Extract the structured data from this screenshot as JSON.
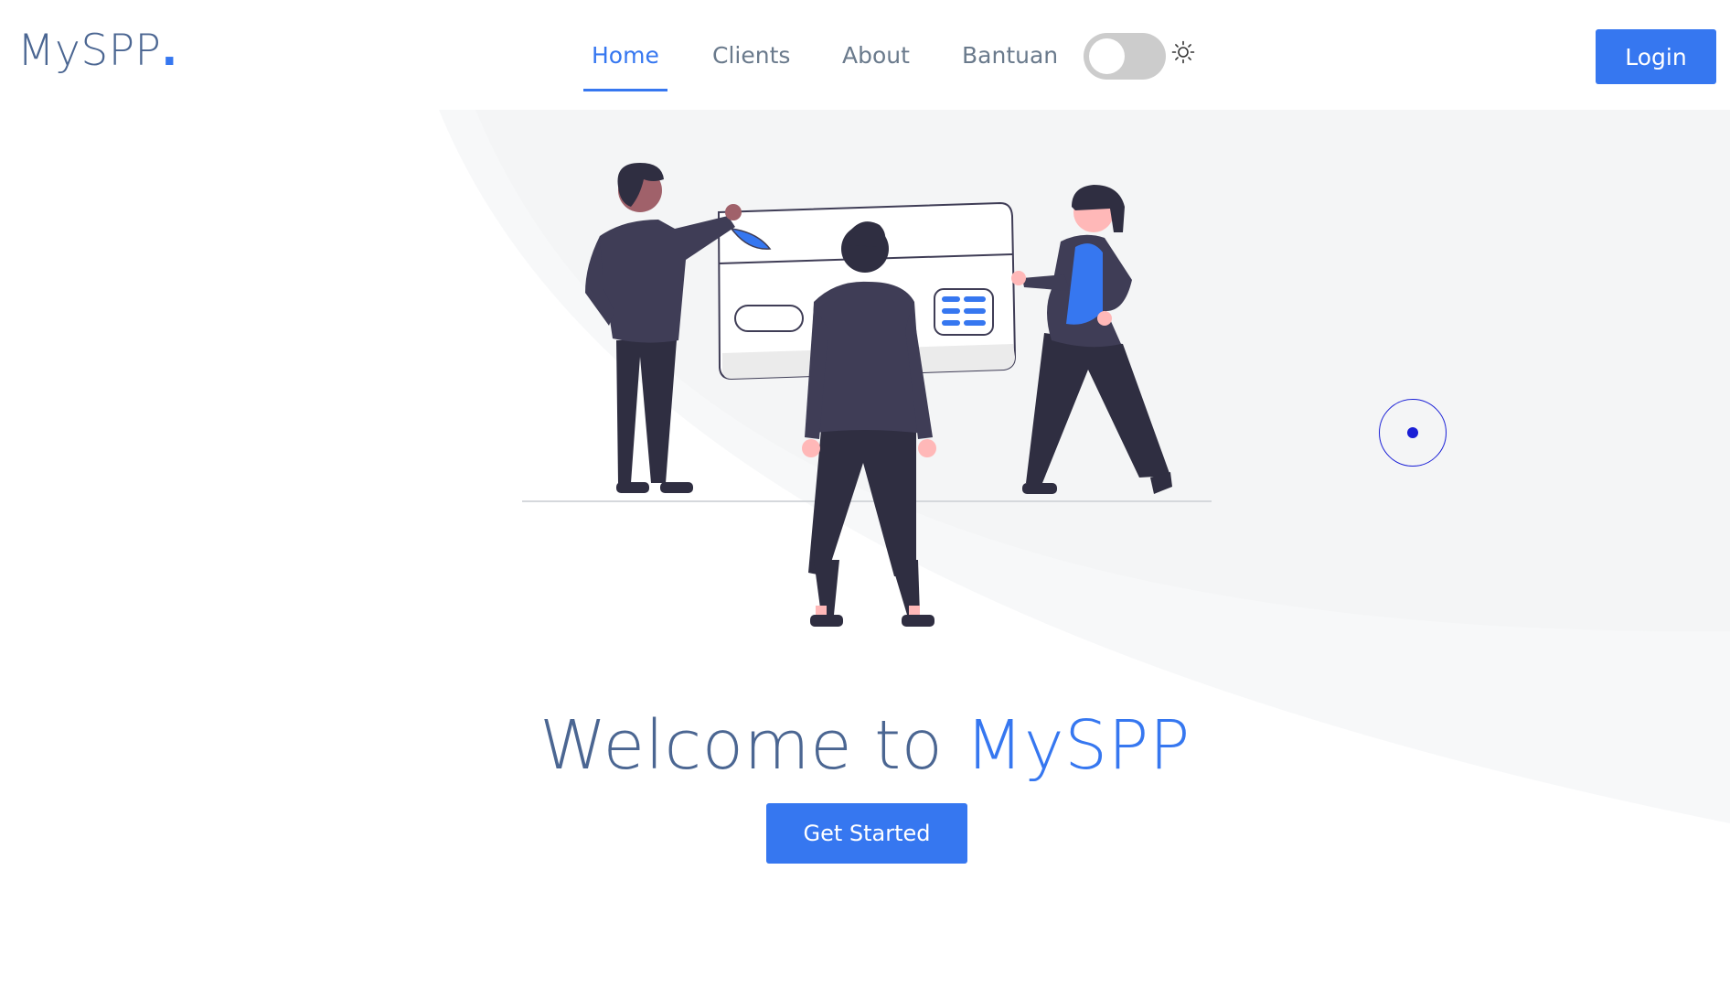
{
  "header": {
    "logo_text": "MySPP",
    "logo_dot": ".",
    "nav": {
      "home": "Home",
      "clients": "Clients",
      "about": "About",
      "bantuan": "Bantuan"
    },
    "theme_toggle": {
      "state": "off",
      "icon": "sun-icon"
    },
    "login_label": "Login"
  },
  "hero": {
    "title_prefix": "Welcome to ",
    "title_brand": "MySPP",
    "cta_label": "Get Started",
    "illustration": "people-with-payment-card-illustration"
  },
  "colors": {
    "accent": "#3677f0",
    "title": "#4b6692",
    "nav_text": "#6a7a8c",
    "illustration_dark": "#3f3d56",
    "skin": "#ffb8b8",
    "cursor": "#1a1fd6"
  }
}
